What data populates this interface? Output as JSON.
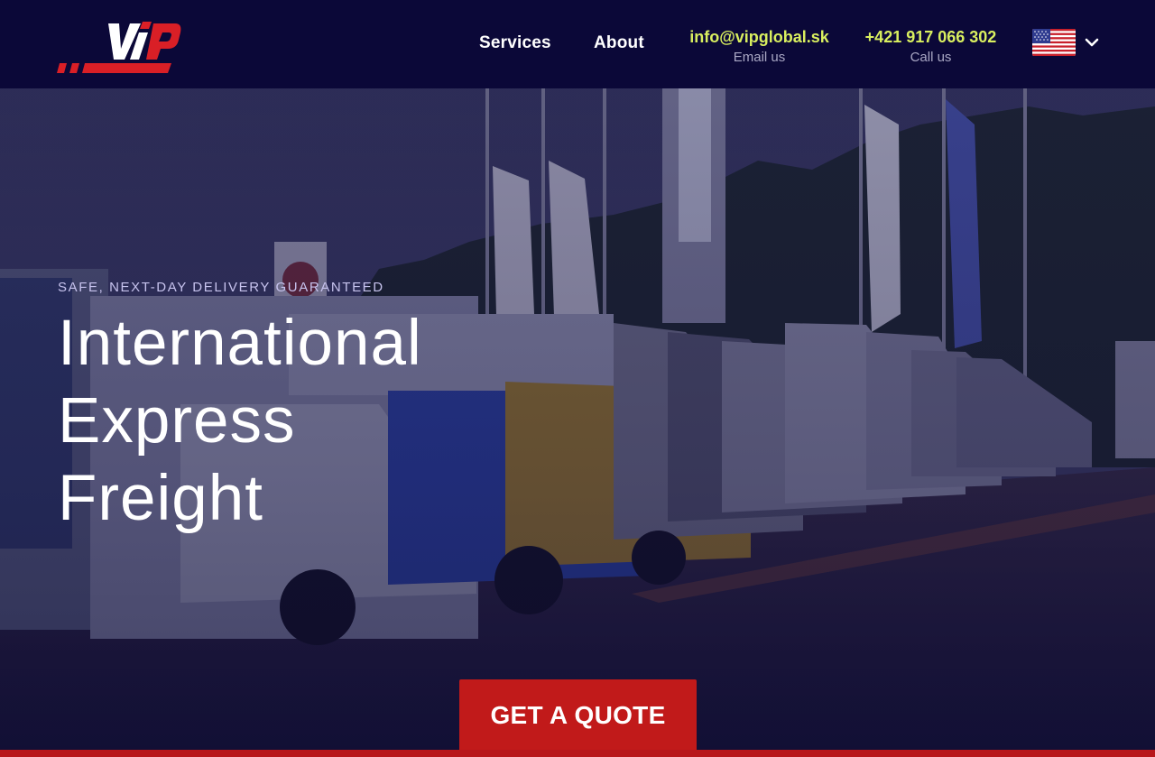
{
  "brand": {
    "logo_text": "ViP",
    "accent_color": "#d91f26"
  },
  "nav": {
    "services_label": "Services",
    "about_label": "About"
  },
  "contacts": {
    "email": {
      "value": "info@vipglobal.sk",
      "label": "Email us"
    },
    "phone": {
      "value": "+421 917 066 302",
      "label": "Call us"
    }
  },
  "language": {
    "flag_icon": "us-flag-icon",
    "chevron_icon": "chevron-down-icon"
  },
  "hero": {
    "tagline": "SAFE, NEXT-DAY DELIVERY GUARANTEED",
    "title_lines": [
      "International",
      "Express",
      "Freight"
    ],
    "cta_label": "GET A QUOTE"
  },
  "colors": {
    "header_bg": "#0b0838",
    "contact_highlight": "#d9ef5f",
    "cta_bg": "#c11a1a"
  }
}
